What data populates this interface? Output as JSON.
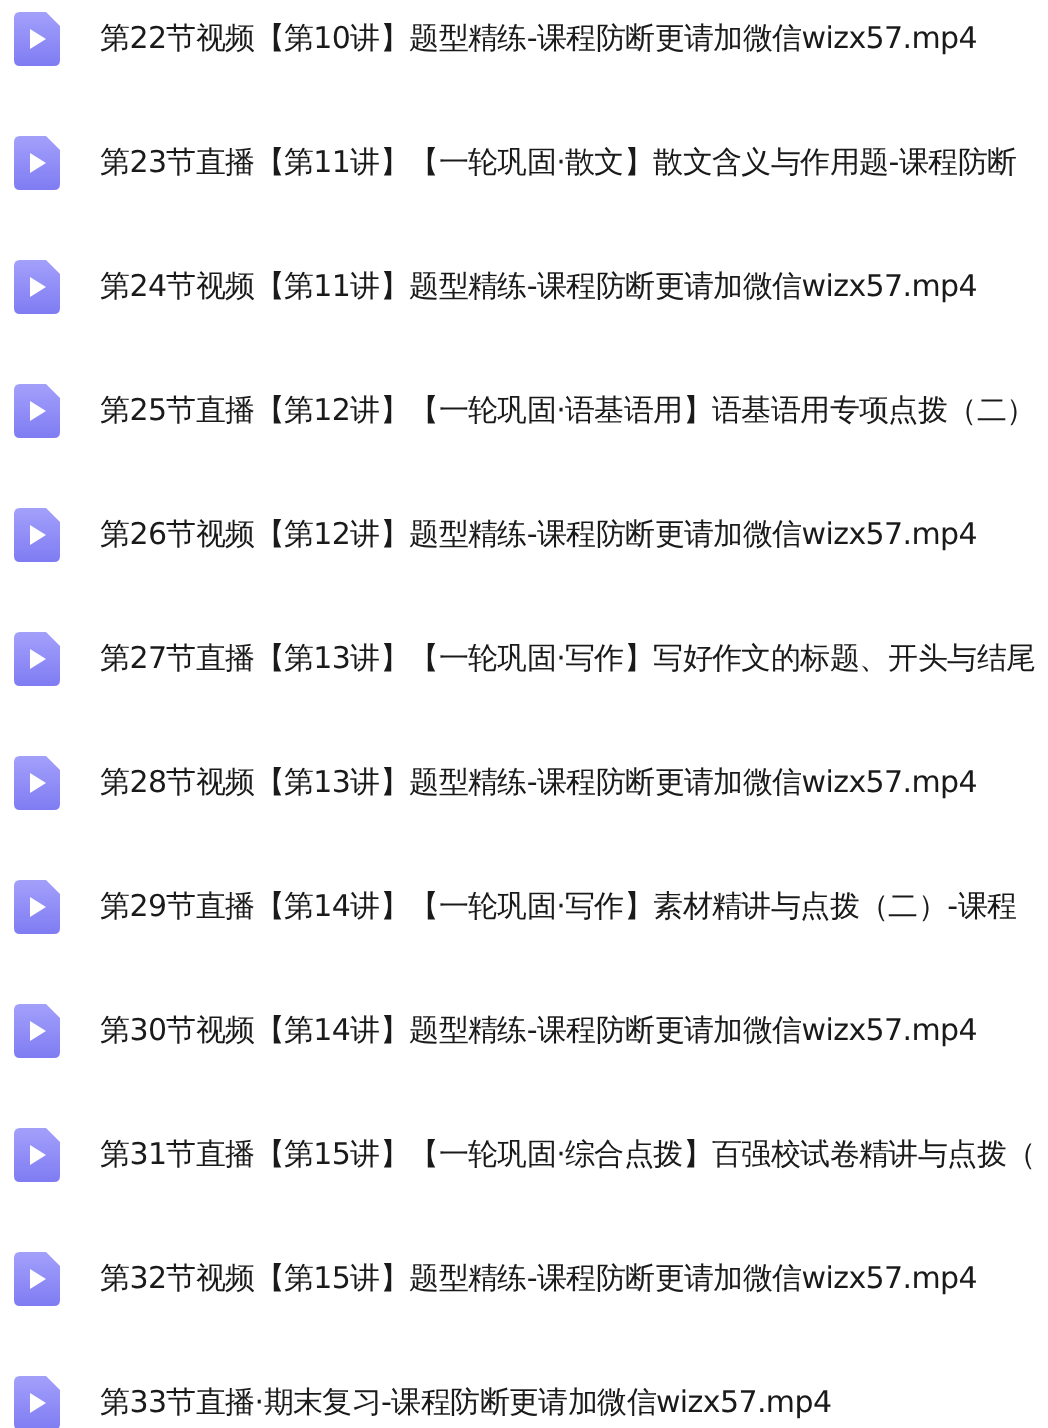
{
  "files": [
    {
      "name": "第22节视频【第10讲】题型精练-课程防断更请加微信wizx57.mp4"
    },
    {
      "name": "第23节直播【第11讲】【一轮巩固·散文】散文含义与作用题-课程防断"
    },
    {
      "name": "第24节视频【第11讲】题型精练-课程防断更请加微信wizx57.mp4"
    },
    {
      "name": "第25节直播【第12讲】【一轮巩固·语基语用】语基语用专项点拨（二）"
    },
    {
      "name": "第26节视频【第12讲】题型精练-课程防断更请加微信wizx57.mp4"
    },
    {
      "name": "第27节直播【第13讲】【一轮巩固·写作】写好作文的标题、开头与结尾"
    },
    {
      "name": "第28节视频【第13讲】题型精练-课程防断更请加微信wizx57.mp4"
    },
    {
      "name": "第29节直播【第14讲】【一轮巩固·写作】素材精讲与点拨（二）-课程"
    },
    {
      "name": "第30节视频【第14讲】题型精练-课程防断更请加微信wizx57.mp4"
    },
    {
      "name": "第31节直播【第15讲】【一轮巩固·综合点拨】百强校试卷精讲与点拨（"
    },
    {
      "name": "第32节视频【第15讲】题型精练-课程防断更请加微信wizx57.mp4"
    },
    {
      "name": "第33节直播·期末复习-课程防断更请加微信wizx57.mp4"
    }
  ]
}
